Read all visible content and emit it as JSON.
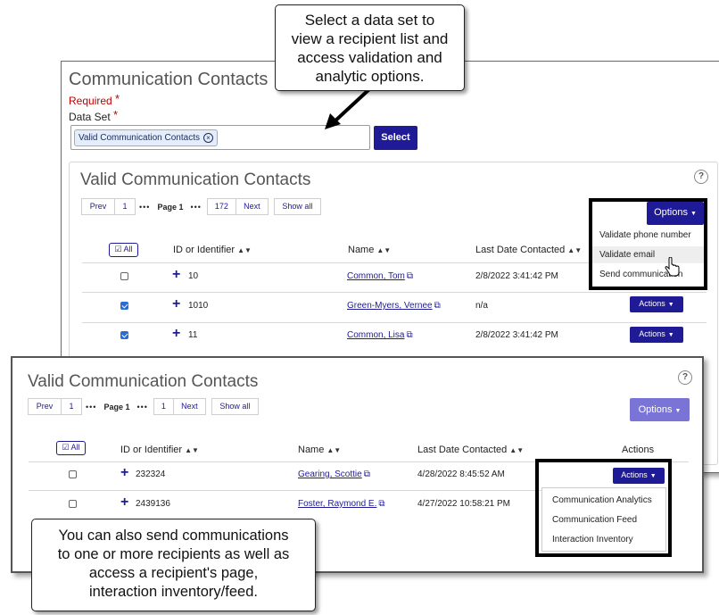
{
  "callout_top": {
    "lines": [
      "Select a data set to",
      "view a recipient list and",
      "access validation and",
      "analytic options."
    ]
  },
  "callout_bottom": {
    "lines": [
      "You can also send communications",
      "to one or more recipients as well as",
      "access a recipient's page,",
      "interaction inventory/feed."
    ]
  },
  "top_panel": {
    "title": "Communication Contacts",
    "required_label": "Required",
    "data_set_label": "Data Set",
    "chip_label": "Valid Communication Contacts",
    "select_button": "Select",
    "card": {
      "title": "Valid Communication Contacts",
      "help": "?",
      "pager": {
        "prev": "Prev",
        "first": "1",
        "dots": "•••",
        "page_text": "Page 1",
        "last": "172",
        "next": "Next",
        "show_all": "Show all"
      },
      "options_button": "Options",
      "options_menu": [
        "Validate phone number",
        "Validate email",
        "Send communication"
      ],
      "all_button": "All",
      "columns": {
        "id": "ID or Identifier",
        "name": "Name",
        "last_date": "Last Date Contacted"
      },
      "rows": [
        {
          "id": "10",
          "name": "Common, Tom",
          "date": "2/8/2022 3:41:42 PM",
          "checked": false,
          "actions": ""
        },
        {
          "id": "1010",
          "name": "Green-Myers, Vernee",
          "date": "n/a",
          "checked": true,
          "actions": "Actions"
        },
        {
          "id": "11",
          "name": "Common, Lisa",
          "date": "2/8/2022 3:41:42 PM",
          "checked": true,
          "actions": "Actions"
        }
      ]
    }
  },
  "bottom_panel": {
    "title": "Valid Communication Contacts",
    "help": "?",
    "pager": {
      "prev": "Prev",
      "first": "1",
      "dots": "•••",
      "page_text": "Page 1",
      "last": "1",
      "next": "Next",
      "show_all": "Show all"
    },
    "options_button": "Options",
    "all_button": "All",
    "columns": {
      "id": "ID or Identifier",
      "name": "Name",
      "last_date": "Last Date Contacted",
      "actions": "Actions"
    },
    "rows": [
      {
        "id": "232324",
        "name": "Gearing, Scottie",
        "date": "4/28/2022 8:45:52 AM",
        "checked": false,
        "actions": "Actions"
      },
      {
        "id": "2439136",
        "name": "Foster, Raymond E.",
        "date": "4/27/2022 10:58:21 PM",
        "checked": false,
        "actions": ""
      }
    ],
    "actions_menu": [
      "Communication Analytics",
      "Communication Feed",
      "Interaction Inventory"
    ]
  },
  "colors": {
    "primary": "#1f1a96",
    "required": "#c00000",
    "options_light": "#7a74d6"
  }
}
